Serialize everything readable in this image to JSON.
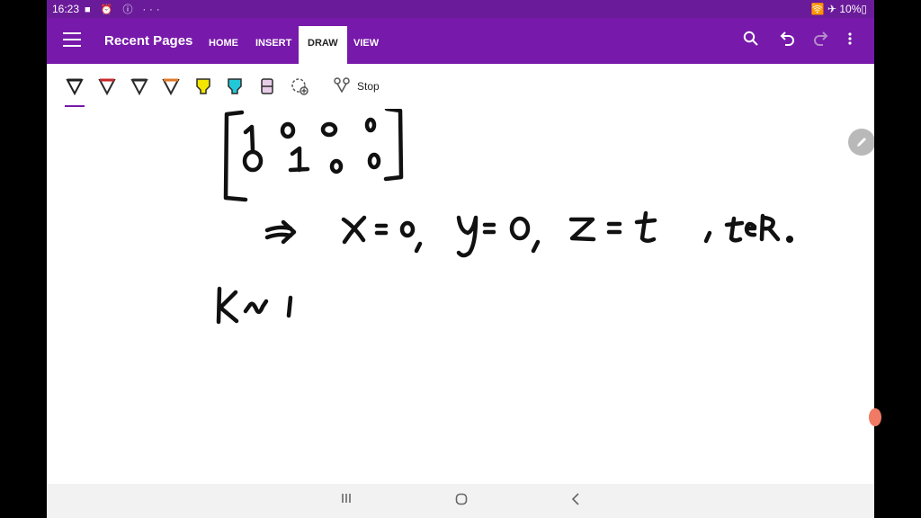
{
  "status": {
    "time": "16:23",
    "left_icons": "■ ⏰ ⓘ ···",
    "right": "🛜 ✈ 10%▯"
  },
  "app": {
    "title": "Recent Pages",
    "tabs": [
      {
        "label": "HOME",
        "active": false
      },
      {
        "label": "INSERT",
        "active": false
      },
      {
        "label": "DRAW",
        "active": true
      },
      {
        "label": "VIEW",
        "active": false
      }
    ],
    "icons": [
      "search-icon",
      "undo-icon",
      "redo-icon",
      "more-icon"
    ]
  },
  "ribbon": {
    "pens": [
      {
        "name": "pen-black-thin",
        "color": "#1f1f1f"
      },
      {
        "name": "pen-red",
        "color": "#c62828"
      },
      {
        "name": "pen-dark",
        "color": "#2b2b2b"
      },
      {
        "name": "pen-orange",
        "color": "#e07a28"
      },
      {
        "name": "highlighter-yellow",
        "color": "#f3e600"
      },
      {
        "name": "highlighter-cyan",
        "color": "#22c8d8"
      },
      {
        "name": "eraser",
        "color": "#e8cde8"
      },
      {
        "name": "lasso-add",
        "color": "#555555"
      }
    ],
    "stop_label": "Stop"
  },
  "canvas": {
    "ink_lines": [
      "1 0 0 0",
      "0 1 0 0",
      "⇒ x=0, y=0, z=t , t∈ℝ.",
      "Ker("
    ]
  },
  "colors": {
    "accent": "#7719aa",
    "status_bar": "#6a1b9a"
  }
}
